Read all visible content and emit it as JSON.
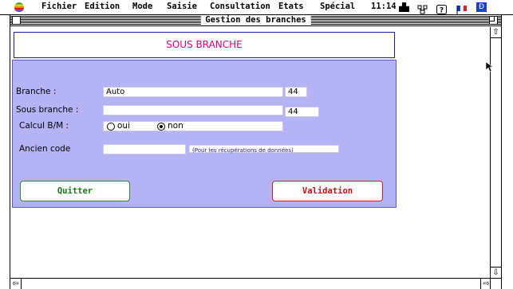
{
  "menubar": {
    "items": [
      "Fichier",
      "Edition",
      "Mode",
      "Saisie",
      "Consultation",
      "Etats",
      "Spécial"
    ],
    "time": "11:14"
  },
  "window": {
    "title": "Gestion des branches"
  },
  "header": {
    "title": "SOUS BRANCHE"
  },
  "form": {
    "branche": {
      "label": "Branche :",
      "value": "Auto",
      "code": "44"
    },
    "sous_branche": {
      "label": "Sous branche :",
      "value": "",
      "code": "44"
    },
    "calcul": {
      "label": "Calcul B/M :",
      "option_oui": "oui",
      "option_non": "non",
      "selected": "non"
    },
    "ancien_code": {
      "label": "Ancien code",
      "value": "",
      "note": "(Pour les récupérations de données)"
    }
  },
  "buttons": {
    "quit": "Quitter",
    "validate": "Validation"
  },
  "colors": {
    "panel": "#b3b3f5",
    "header_title": "#e0007a",
    "quit_border": "#2e8b2e",
    "quit_text": "#1a7a1a",
    "validate_border": "#d02020",
    "validate_text": "#c01010"
  }
}
